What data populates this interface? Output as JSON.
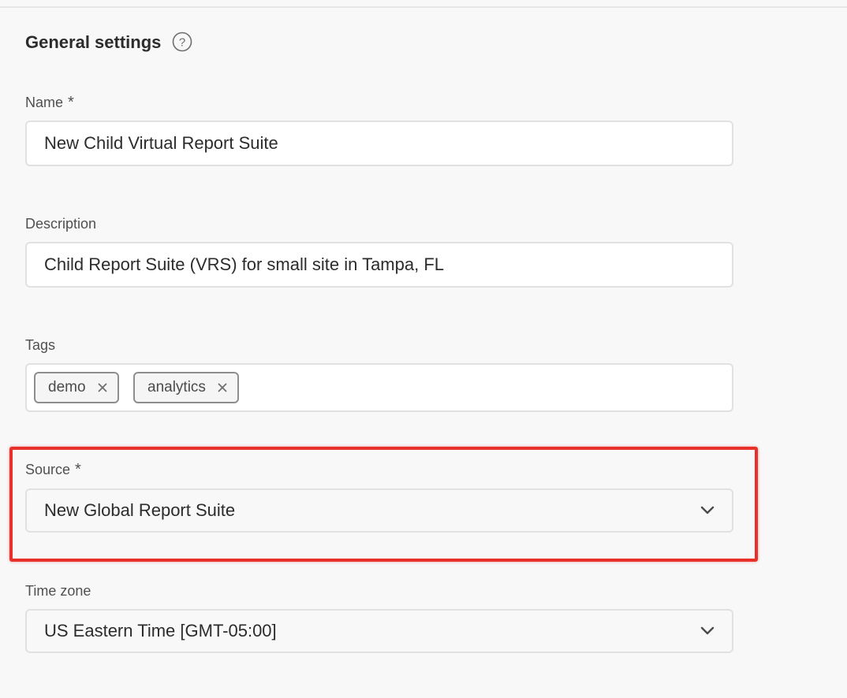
{
  "section": {
    "title": "General settings",
    "help_icon": "question-circle-icon"
  },
  "fields": {
    "name": {
      "label": "Name",
      "required_mark": "*",
      "value": "New Child Virtual Report Suite"
    },
    "description": {
      "label": "Description",
      "value": "Child Report Suite (VRS) for small site in Tampa, FL"
    },
    "tags": {
      "label": "Tags",
      "items": [
        {
          "label": "demo",
          "remove_icon": "close-icon"
        },
        {
          "label": "analytics",
          "remove_icon": "close-icon"
        }
      ]
    },
    "source": {
      "label": "Source",
      "required_mark": "*",
      "value": "New Global Report Suite",
      "dropdown_icon": "chevron-down-icon"
    },
    "timezone": {
      "label": "Time zone",
      "value": "US Eastern Time [GMT-05:00]",
      "dropdown_icon": "chevron-down-icon"
    }
  },
  "colors": {
    "highlight_border": "#e8312a",
    "page_background": "#f8f8f8",
    "input_background": "#ffffff",
    "input_border": "#e1e1e1",
    "tag_border": "#8e8e8e"
  }
}
